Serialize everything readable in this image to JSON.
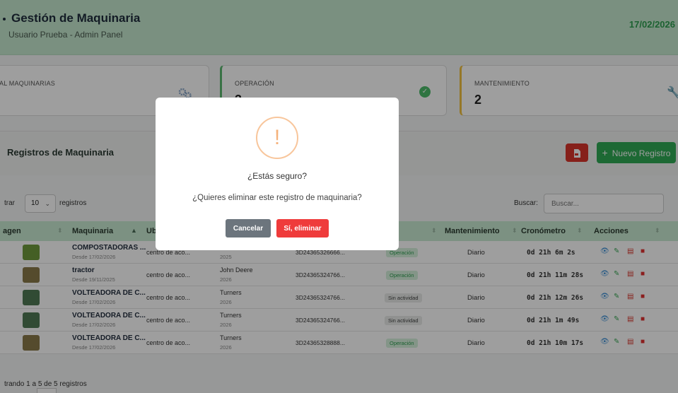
{
  "header": {
    "title": "Gestión de Maquinaria",
    "subtitle": "Usuario Prueba - Admin Panel",
    "date": "17/02/2026"
  },
  "stats": {
    "total_label": "AL MAQUINARIAS",
    "operacion_label": "OPERACIÓN",
    "operacion_value": "3",
    "mantenimiento_label": "MANTENIMIENTO",
    "mantenimiento_value": "2"
  },
  "panel": {
    "title": "Registros de Maquinaria",
    "new_label": "Nuevo Registro"
  },
  "controls": {
    "show_prefix": "trar",
    "page_length": "10",
    "show_suffix": "registros",
    "search_label": "Buscar:",
    "search_placeholder": "Buscar..."
  },
  "table": {
    "columns": {
      "imagen": "agen",
      "maquinaria": "Maquinaria",
      "ubicacion": "Ub",
      "mantenimiento": "Mantenimiento",
      "cronometro": "Cronómetro",
      "acciones": "Acciones"
    },
    "rows": [
      {
        "name": "COMPOSTADORAS ...",
        "desde": "Desde 17/02/2026",
        "ubicacion": "centro de aco...",
        "marca": "Turners",
        "anio": "2025",
        "serie": "3D24365326666...",
        "estado": "Operación",
        "mant": "Diario",
        "crono": "0d 21h 6m 2s"
      },
      {
        "name": "tractor",
        "desde": "Desde 19/11/2025",
        "ubicacion": "centro de aco...",
        "marca": "John Deere",
        "anio": "2026",
        "serie": "3D24365324766...",
        "estado": "Operación",
        "mant": "Diario",
        "crono": "0d 21h 11m 28s"
      },
      {
        "name": "VOLTEADORA DE C...",
        "desde": "Desde 17/02/2026",
        "ubicacion": "centro de aco...",
        "marca": "Turners",
        "anio": "2026",
        "serie": "3D24365324766...",
        "estado": "Sin actividad",
        "mant": "Diario",
        "crono": "0d 21h 12m 26s"
      },
      {
        "name": "VOLTEADORA DE C...",
        "desde": "Desde 17/02/2026",
        "ubicacion": "centro de aco...",
        "marca": "Turners",
        "anio": "2026",
        "serie": "3D24365324766...",
        "estado": "Sin actividad",
        "mant": "Diario",
        "crono": "0d 21h 1m 49s"
      },
      {
        "name": "VOLTEADORA DE C...",
        "desde": "Desde 17/02/2026",
        "ubicacion": "centro de aco...",
        "marca": "Turners",
        "anio": "2026",
        "serie": "3D24365328888...",
        "estado": "Operación",
        "mant": "Diario",
        "crono": "0d 21h 10m 17s"
      }
    ]
  },
  "footer": {
    "info": "trando 1 a 5 de 5 registros"
  },
  "modal": {
    "icon": "!",
    "title": "¿Estás seguro?",
    "text": "¿Quieres eliminar este registro de maquinaria?",
    "cancel_label": "Cancelar",
    "confirm_label": "Sí, eliminar"
  },
  "colors": {
    "accent_green": "#2faa55",
    "danger_red": "#ef3b3b",
    "warning_orange": "#f5b27b"
  }
}
